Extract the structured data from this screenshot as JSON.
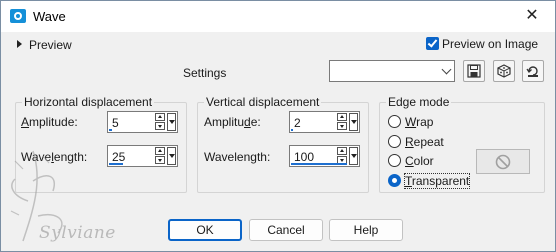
{
  "window": {
    "title": "Wave",
    "close_glyph": "✕"
  },
  "preview": {
    "label": "Preview",
    "preview_on_image_label": "Preview on Image",
    "preview_on_image_checked": true
  },
  "settings": {
    "label": "Settings",
    "selected_value": ""
  },
  "toolbar_icons": [
    "save-icon",
    "dice-icon",
    "reset-icon"
  ],
  "horizontal": {
    "title": "Horizontal displacement",
    "amplitude": {
      "label_underline": "A",
      "label_rest": "mplitude:",
      "value": "5",
      "level": 0.05
    },
    "wavelength": {
      "label_pre": "Wave",
      "label_underline": "l",
      "label_rest": "ength:",
      "value": "25",
      "level": 0.25
    }
  },
  "vertical": {
    "title": "Vertical displacement",
    "amplitude": {
      "label_pre": "Amplitu",
      "label_underline": "d",
      "label_rest": "e:",
      "value": "2",
      "level": 0.02
    },
    "wavelength": {
      "label_pre": "Wavelen",
      "label_underline": "g",
      "label_rest": "th:",
      "value": "100",
      "level": 1.0
    }
  },
  "edge_mode": {
    "title": "Edge mode",
    "options": [
      {
        "pre": "",
        "underline": "W",
        "rest": "rap",
        "selected": false
      },
      {
        "pre": "",
        "underline": "R",
        "rest": "epeat",
        "selected": false
      },
      {
        "pre": "",
        "underline": "C",
        "rest": "olor",
        "selected": false
      },
      {
        "pre": "",
        "underline": "T",
        "rest": "ransparent",
        "selected": true
      }
    ]
  },
  "buttons": {
    "ok": "OK",
    "cancel": "Cancel",
    "help": "Help"
  },
  "watermark": {
    "text": "Sylviane"
  },
  "colors": {
    "accent": "#0a64c8",
    "bg": "#f0f0f0",
    "border": "#d4d4d4"
  }
}
